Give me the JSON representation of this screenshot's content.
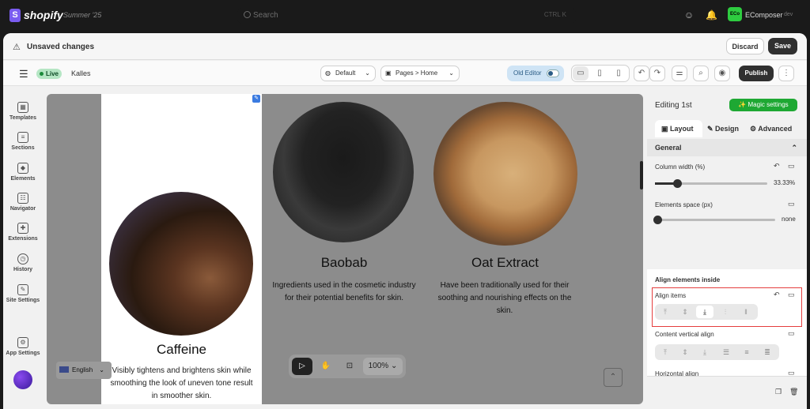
{
  "topbar": {
    "brand": "shopify",
    "edition": "Summer '25",
    "search_placeholder": "Search",
    "shortcut": "CTRL   K",
    "store_avatar": "ECo",
    "store_name": "EComposer",
    "store_tag": "dev"
  },
  "notice": {
    "title": "Unsaved changes",
    "discard": "Discard",
    "save": "Save"
  },
  "toolbar": {
    "live": "Live",
    "theme": "Kalles",
    "template": "Default",
    "page": "Pages  >  Home",
    "old_editor": "Old Editor",
    "publish": "Publish"
  },
  "sidebar": {
    "items": [
      {
        "label": "Templates",
        "icon": "templates-icon"
      },
      {
        "label": "Sections",
        "icon": "sections-icon"
      },
      {
        "label": "Elements",
        "icon": "elements-icon"
      },
      {
        "label": "Navigator",
        "icon": "navigator-icon"
      },
      {
        "label": "Extensions",
        "icon": "extensions-icon"
      },
      {
        "label": "History",
        "icon": "history-icon"
      },
      {
        "label": "Site Settings",
        "icon": "site-settings-icon"
      },
      {
        "label": "App Settings",
        "icon": "app-settings-icon"
      }
    ]
  },
  "canvas": {
    "columns": [
      {
        "title": "Caffeine",
        "text": "Visibly tightens and brightens skin while smoothing the look of uneven tone result in smoother skin."
      },
      {
        "title": "Baobab",
        "text": "Ingredients used in the cosmetic industry for their potential benefits for skin."
      },
      {
        "title": "Oat Extract",
        "text": "Have been traditionally used for their soothing and nourishing effects on the skin."
      }
    ],
    "language": "English",
    "zoom": "100%"
  },
  "panel": {
    "editing": "Editing 1st",
    "magic": "Magic settings",
    "tabs": [
      "Layout",
      "Design",
      "Advanced"
    ],
    "general": "General",
    "column_width_label": "Column width (%)",
    "column_width_value": "33.33%",
    "column_width_fraction": 0.2,
    "elements_space_label": "Elements space (px)",
    "elements_space_value": "none",
    "align_section": "Align elements inside",
    "align_items": "Align items",
    "content_vertical": "Content vertical align",
    "horizontal": "Horizontal align"
  },
  "colors": {
    "accent": "#1ea833",
    "highlight": "#e53e3e",
    "live": "#b5e6c4"
  }
}
